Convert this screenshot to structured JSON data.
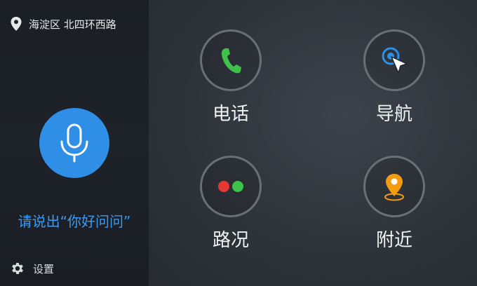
{
  "location": {
    "icon": "location-pin-icon",
    "text": "海淀区 北四环西路"
  },
  "voice": {
    "icon": "microphone-icon",
    "hint": "请说出“你好问问”"
  },
  "settings": {
    "icon": "gear-icon",
    "label": "设置"
  },
  "tiles": [
    {
      "label": "电话",
      "icon": "phone-icon",
      "color": "#3ec24a"
    },
    {
      "label": "导航",
      "icon": "navigation-icon",
      "color": "#2f8ee5"
    },
    {
      "label": "路况",
      "icon": "traffic-lights-icon",
      "colors": [
        "#e53935",
        "#3ec24a"
      ]
    },
    {
      "label": "附近",
      "icon": "nearby-pin-icon",
      "color": "#f39c12"
    }
  ],
  "colors": {
    "accent": "#2f8ee5",
    "sidebar_bg": "#1e2329",
    "main_bg": "#353a41"
  }
}
